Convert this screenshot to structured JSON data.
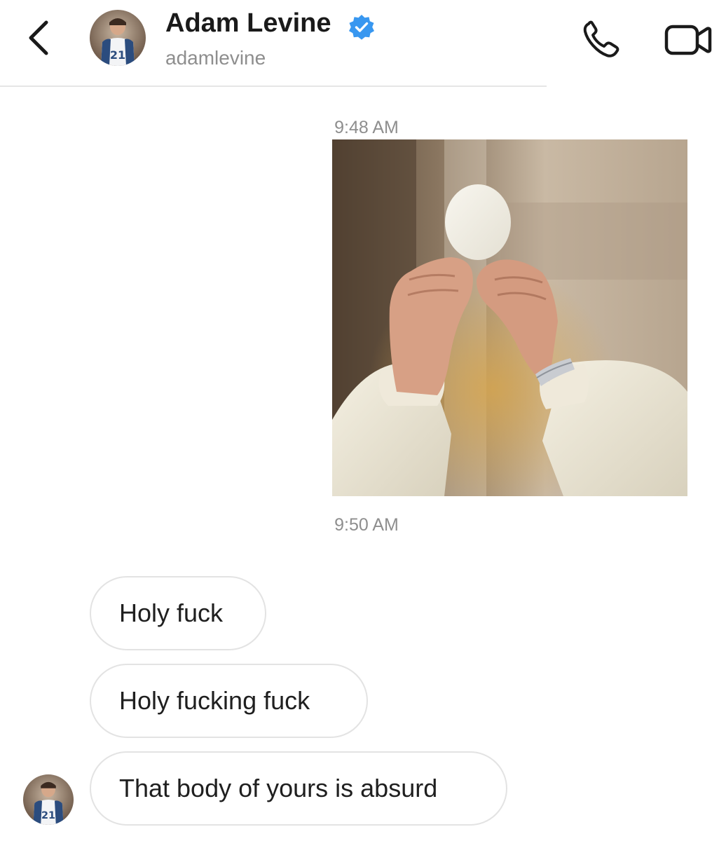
{
  "header": {
    "name": "Adam Levine",
    "handle": "adamlevine",
    "back_icon": "chevron-left-icon",
    "verified_icon": "verified-badge-icon",
    "call_icon": "phone-icon",
    "video_icon": "video-camera-icon",
    "avatar_jersey_number": "21",
    "accent_color": "#3897f0"
  },
  "conversation": {
    "timestamps": [
      "9:48 AM",
      "9:50 AM"
    ],
    "sent_photo_icon": "photo",
    "received_messages": [
      "Holy fuck",
      "Holy fucking fuck",
      "That body of yours is absurd"
    ]
  }
}
